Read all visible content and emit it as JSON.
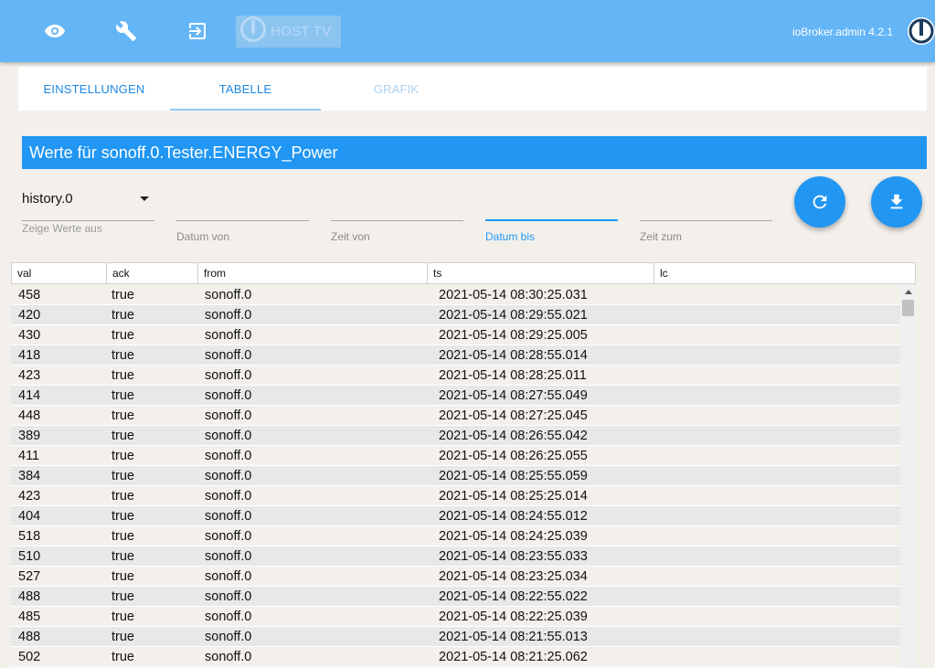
{
  "app": {
    "host_label": "HOST TV",
    "version_label": "ioBroker.admin 4.2.1"
  },
  "topbar_icons": [
    "eye-icon",
    "wrench-icon",
    "logout-icon"
  ],
  "tabs": [
    {
      "label": "EINSTELLUNGEN"
    },
    {
      "label": "TABELLE"
    },
    {
      "label": "GRAFIK"
    }
  ],
  "title": "Werte für sonoff.0.Tester.ENERGY_Power",
  "controls": {
    "instance_value": "history.0",
    "instance_label": "Zeige Werte aus",
    "date_from_label": "Datum von",
    "time_from_label": "Zeit von",
    "date_to_label": "Datum bis",
    "time_to_label": "Zeit zum"
  },
  "colors": {
    "topbar": "#64b5f6",
    "accent": "#2196f3",
    "background": "#f3f0ec"
  },
  "table": {
    "columns": [
      "val",
      "ack",
      "from",
      "ts",
      "lc"
    ],
    "rows": [
      {
        "val": "458",
        "ack": "true",
        "from": "sonoff.0",
        "ts": "2021-05-14 08:30:25.031",
        "lc": ""
      },
      {
        "val": "420",
        "ack": "true",
        "from": "sonoff.0",
        "ts": "2021-05-14 08:29:55.021",
        "lc": ""
      },
      {
        "val": "430",
        "ack": "true",
        "from": "sonoff.0",
        "ts": "2021-05-14 08:29:25.005",
        "lc": ""
      },
      {
        "val": "418",
        "ack": "true",
        "from": "sonoff.0",
        "ts": "2021-05-14 08:28:55.014",
        "lc": ""
      },
      {
        "val": "423",
        "ack": "true",
        "from": "sonoff.0",
        "ts": "2021-05-14 08:28:25.011",
        "lc": ""
      },
      {
        "val": "414",
        "ack": "true",
        "from": "sonoff.0",
        "ts": "2021-05-14 08:27:55.049",
        "lc": ""
      },
      {
        "val": "448",
        "ack": "true",
        "from": "sonoff.0",
        "ts": "2021-05-14 08:27:25.045",
        "lc": ""
      },
      {
        "val": "389",
        "ack": "true",
        "from": "sonoff.0",
        "ts": "2021-05-14 08:26:55.042",
        "lc": ""
      },
      {
        "val": "411",
        "ack": "true",
        "from": "sonoff.0",
        "ts": "2021-05-14 08:26:25.055",
        "lc": ""
      },
      {
        "val": "384",
        "ack": "true",
        "from": "sonoff.0",
        "ts": "2021-05-14 08:25:55.059",
        "lc": ""
      },
      {
        "val": "423",
        "ack": "true",
        "from": "sonoff.0",
        "ts": "2021-05-14 08:25:25.014",
        "lc": ""
      },
      {
        "val": "404",
        "ack": "true",
        "from": "sonoff.0",
        "ts": "2021-05-14 08:24:55.012",
        "lc": ""
      },
      {
        "val": "518",
        "ack": "true",
        "from": "sonoff.0",
        "ts": "2021-05-14 08:24:25.039",
        "lc": ""
      },
      {
        "val": "510",
        "ack": "true",
        "from": "sonoff.0",
        "ts": "2021-05-14 08:23:55.033",
        "lc": ""
      },
      {
        "val": "527",
        "ack": "true",
        "from": "sonoff.0",
        "ts": "2021-05-14 08:23:25.034",
        "lc": ""
      },
      {
        "val": "488",
        "ack": "true",
        "from": "sonoff.0",
        "ts": "2021-05-14 08:22:55.022",
        "lc": ""
      },
      {
        "val": "485",
        "ack": "true",
        "from": "sonoff.0",
        "ts": "2021-05-14 08:22:25.039",
        "lc": ""
      },
      {
        "val": "488",
        "ack": "true",
        "from": "sonoff.0",
        "ts": "2021-05-14 08:21:55.013",
        "lc": ""
      },
      {
        "val": "502",
        "ack": "true",
        "from": "sonoff.0",
        "ts": "2021-05-14 08:21:25.062",
        "lc": ""
      }
    ]
  }
}
